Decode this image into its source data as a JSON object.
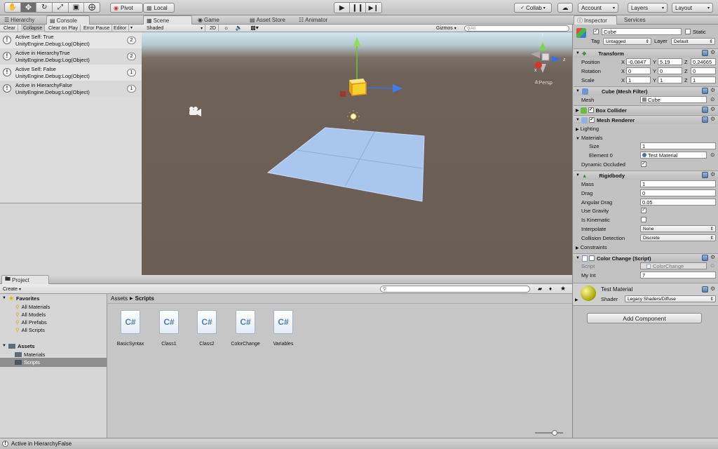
{
  "toolbar": {
    "pivot": "Pivot",
    "local": "Local",
    "collab": "Collab",
    "account": "Account",
    "layers": "Layers",
    "layout": "Layout"
  },
  "tabs": {
    "hierarchy": "Hierarchy",
    "console": "Console",
    "scene": "Scene",
    "game": "Game",
    "asset_store": "Asset Store",
    "animator": "Animator",
    "inspector": "Inspector",
    "services": "Services",
    "project": "Project"
  },
  "console": {
    "buttons": [
      "Clear",
      "Collapse",
      "Clear on Play",
      "Error Pause",
      "Editor"
    ],
    "entries": [
      {
        "line1": "Active Self: True",
        "line2": "UnityEngine.Debug:Log(Object)",
        "count": "2"
      },
      {
        "line1": "Active in HierarchyTrue",
        "line2": "UnityEngine.Debug:Log(Object)",
        "count": "2"
      },
      {
        "line1": "Active Self: False",
        "line2": "UnityEngine.Debug:Log(Object)",
        "count": "1"
      },
      {
        "line1": "Active in HierarchyFalse",
        "line2": "UnityEngine.Debug:Log(Object)",
        "count": "1"
      }
    ]
  },
  "scene": {
    "shading": "Shaded",
    "mode_2d": "2D",
    "gizmos": "Gizmos",
    "search_placeholder": "All",
    "persp": "Persp",
    "axis_x": "x",
    "axis_z": "z",
    "axis_y": "y"
  },
  "inspector": {
    "object_name": "Cube",
    "static_label": "Static",
    "tag_label": "Tag",
    "tag_value": "Untagged",
    "layer_label": "Layer",
    "layer_value": "Default",
    "transform": {
      "title": "Transform",
      "position_label": "Position",
      "rotation_label": "Rotation",
      "scale_label": "Scale",
      "x": "X",
      "y": "Y",
      "z": "Z",
      "position": [
        "-0.0847",
        "5.19",
        "0.24665"
      ],
      "rotation": [
        "0",
        "0",
        "0"
      ],
      "scale": [
        "1",
        "1",
        "1"
      ]
    },
    "mesh_filter": {
      "title": "Cube (Mesh Filter)",
      "mesh_label": "Mesh",
      "mesh_value": "Cube"
    },
    "box_collider": {
      "title": "Box Collider"
    },
    "mesh_renderer": {
      "title": "Mesh Renderer",
      "lighting": "Lighting",
      "materials": "Materials",
      "size_label": "Size",
      "size_value": "1",
      "element_label": "Element 0",
      "element_value": "Test Material",
      "dynamic_occluded": "Dynamic Occluded"
    },
    "rigidbody": {
      "title": "Rigidbody",
      "mass_label": "Mass",
      "mass_value": "1",
      "drag_label": "Drag",
      "drag_value": "0",
      "angular_drag_label": "Angular Drag",
      "angular_drag_value": "0.05",
      "use_gravity": "Use Gravity",
      "is_kinematic": "Is Kinematic",
      "interpolate_label": "Interpolate",
      "interpolate_value": "None",
      "collision_label": "Collision Detection",
      "collision_value": "Discrete",
      "constraints": "Constraints"
    },
    "color_change": {
      "title": "Color Change (Script)",
      "script_label": "Script",
      "script_value": "ColorChange",
      "myint_label": "My Int",
      "myint_value": "7"
    },
    "material": {
      "title": "Test Material",
      "shader_label": "Shader",
      "shader_value": "Legacy Shaders/Diffuse"
    },
    "add_component": "Add Component"
  },
  "project": {
    "create": "Create",
    "favorites": "Favorites",
    "favorite_items": [
      "All Materials",
      "All Models",
      "All Prefabs",
      "All Scripts"
    ],
    "assets": "Assets",
    "asset_folders": [
      "Materials",
      "Scripts"
    ],
    "breadcrumb_root": "Assets",
    "breadcrumb_current": "Scripts",
    "files": [
      "BasicSyntax",
      "Class1",
      "Class2",
      "ColorChange",
      "Variables"
    ],
    "file_icon_text": "C#"
  },
  "status_bar": {
    "message": "Active in HierarchyFalse"
  }
}
